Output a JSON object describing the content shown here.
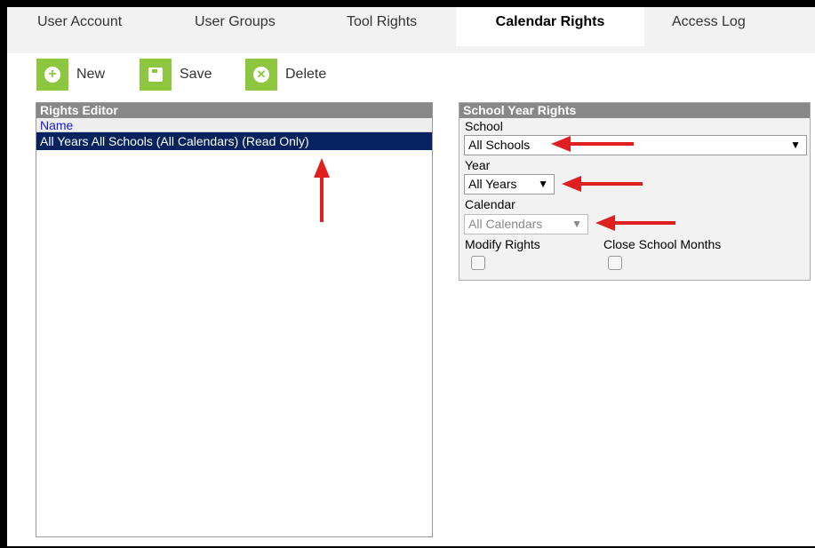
{
  "tabs": [
    {
      "label": "User Account"
    },
    {
      "label": "User Groups"
    },
    {
      "label": "Tool Rights"
    },
    {
      "label": "Calendar Rights",
      "active": true
    },
    {
      "label": "Access Log"
    }
  ],
  "toolbar": {
    "new_label": "New",
    "save_label": "Save",
    "delete_label": "Delete"
  },
  "rights_editor": {
    "title": "Rights Editor",
    "column_header": "Name",
    "rows": [
      {
        "name": "All Years All Schools (All Calendars) (Read Only)",
        "selected": true
      }
    ]
  },
  "school_year_rights": {
    "title": "School Year Rights",
    "school_label": "School",
    "school_value": "All Schools",
    "year_label": "Year",
    "year_value": "All Years",
    "calendar_label": "Calendar",
    "calendar_value": "All Calendars",
    "calendar_disabled": true,
    "modify_rights_label": "Modify Rights",
    "modify_rights_checked": false,
    "close_school_months_label": "Close School Months",
    "close_school_months_checked": false
  },
  "annotation_color": "#e02020",
  "accent_green": "#8dc63f",
  "selected_row_color": "#06235f"
}
